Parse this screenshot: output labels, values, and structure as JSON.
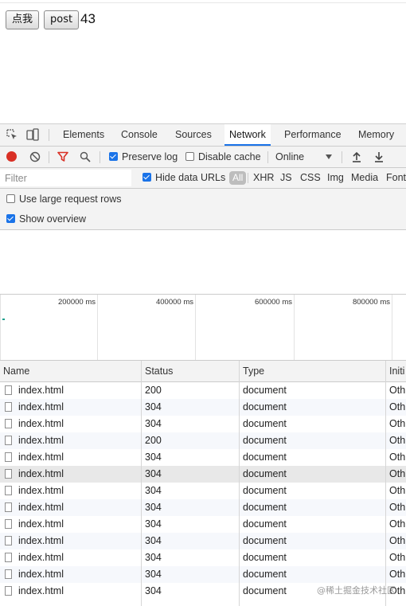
{
  "page": {
    "btn_click": "点我",
    "btn_post": "post",
    "counter": "43"
  },
  "devtools": {
    "tabs": [
      "Elements",
      "Console",
      "Sources",
      "Network",
      "Performance",
      "Memory"
    ],
    "active_tab": "Network",
    "toolbar": {
      "preserve_log": "Preserve log",
      "preserve_log_checked": true,
      "disable_cache": "Disable cache",
      "disable_cache_checked": false,
      "throttle": "Online"
    },
    "filter": {
      "placeholder": "Filter",
      "hide_data_urls": "Hide data URLs",
      "hide_data_urls_checked": true,
      "types": [
        "All",
        "XHR",
        "JS",
        "CSS",
        "Img",
        "Media",
        "Font"
      ]
    },
    "settings": {
      "large_rows": "Use large request rows",
      "large_rows_checked": false,
      "show_overview": "Show overview",
      "show_overview_checked": true
    },
    "overview": {
      "ticks": [
        "200000 ms",
        "400000 ms",
        "600000 ms",
        "800000 ms"
      ]
    },
    "columns": [
      "Name",
      "Status",
      "Type",
      "Initi"
    ],
    "rows": [
      {
        "name": "index.html",
        "status": "200",
        "type": "document",
        "initiator": "Oth"
      },
      {
        "name": "index.html",
        "status": "304",
        "type": "document",
        "initiator": "Oth"
      },
      {
        "name": "index.html",
        "status": "304",
        "type": "document",
        "initiator": "Oth"
      },
      {
        "name": "index.html",
        "status": "200",
        "type": "document",
        "initiator": "Oth"
      },
      {
        "name": "index.html",
        "status": "304",
        "type": "document",
        "initiator": "Oth"
      },
      {
        "name": "index.html",
        "status": "304",
        "type": "document",
        "initiator": "Oth"
      },
      {
        "name": "index.html",
        "status": "304",
        "type": "document",
        "initiator": "Oth"
      },
      {
        "name": "index.html",
        "status": "304",
        "type": "document",
        "initiator": "Oth"
      },
      {
        "name": "index.html",
        "status": "304",
        "type": "document",
        "initiator": "Oth"
      },
      {
        "name": "index.html",
        "status": "304",
        "type": "document",
        "initiator": "Oth"
      },
      {
        "name": "index.html",
        "status": "304",
        "type": "document",
        "initiator": "Oth"
      },
      {
        "name": "index.html",
        "status": "304",
        "type": "document",
        "initiator": "Oth"
      },
      {
        "name": "index.html",
        "status": "304",
        "type": "document",
        "initiator": "Oth"
      }
    ]
  },
  "watermark": "@稀土掘金技术社区",
  "colors": {
    "accent": "#1a73e8",
    "record": "#d93025",
    "filter_icon": "#d93025"
  }
}
